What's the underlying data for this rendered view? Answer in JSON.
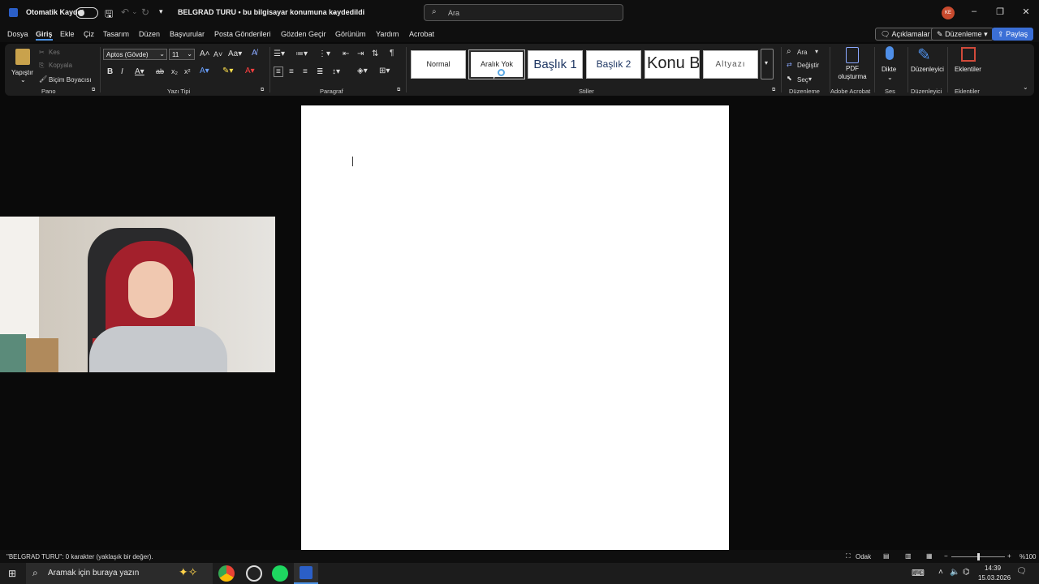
{
  "titlebar": {
    "autosave_label": "Otomatik Kaydet",
    "doc_title": "BELGRAD TURU • bu bilgisayar konumuna kaydedildi",
    "search_placeholder": "Ara",
    "avatar_initials": "KE"
  },
  "menu": {
    "items": [
      "Dosya",
      "Giriş",
      "Ekle",
      "Çiz",
      "Tasarım",
      "Düzen",
      "Başvurular",
      "Posta Gönderileri",
      "Gözden Geçir",
      "Görünüm",
      "Yardım",
      "Acrobat"
    ],
    "active": "Giriş",
    "comments_label": "Açıklamalar",
    "editing_label": "Düzenleme",
    "share_label": "Paylaş"
  },
  "ribbon": {
    "clipboard": {
      "paste": "Yapıştır",
      "cut": "Kes",
      "copy": "Kopyala",
      "format_painter": "Biçim Boyacısı",
      "group": "Pano"
    },
    "font": {
      "family": "Aptos (Gövde)",
      "size": "11",
      "group": "Yazı Tipi"
    },
    "paragraph": {
      "group": "Paragraf"
    },
    "styles": {
      "items": [
        "Normal",
        "Aralık Yok",
        "Başlık 1",
        "Başlık 2",
        "Konu B",
        "Altyazı"
      ],
      "group": "Stiller"
    },
    "editing": {
      "find": "Ara",
      "replace": "Değiştir",
      "select": "Seç",
      "group": "Düzenleme"
    },
    "acrobat": {
      "button": "PDF oluşturma",
      "group": "Adobe Acrobat"
    },
    "voice": {
      "button": "Dikte",
      "group": "Ses"
    },
    "editor": {
      "button": "Düzenleyici",
      "group": "Düzenleyici"
    },
    "addins": {
      "button": "Eklentiler",
      "group": "Eklentiler"
    }
  },
  "status": {
    "word_count": "\"BELGRAD TURU\": 0 karakter (yaklaşık bir değer).",
    "focus": "Odak",
    "zoom": "%100"
  },
  "taskbar": {
    "search_placeholder": "Aramak için buraya yazın",
    "time": "14:39",
    "date": "15.03.2026"
  },
  "colors": {
    "accent": "#4a90e2",
    "share_button": "#3b6fd6",
    "avatar": "#c84a2e"
  }
}
